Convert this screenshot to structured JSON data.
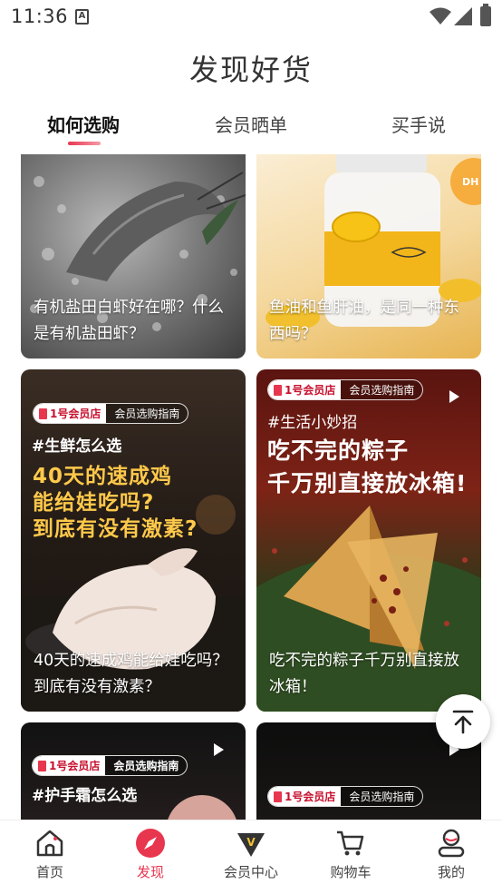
{
  "status_bar": {
    "time": "11:36",
    "sim_label": "A"
  },
  "header": {
    "title": "发现好货",
    "tabs": [
      {
        "label": "如何选购",
        "active": true
      },
      {
        "label": "会员晒单",
        "active": false
      },
      {
        "label": "买手说",
        "active": false
      }
    ]
  },
  "feed": {
    "cards": [
      {
        "caption": "有机盐田白虾好在哪？什么是有机盐田虾？"
      },
      {
        "caption": "鱼油和鱼肝油，是同一种东西吗？",
        "image_text": "DH"
      },
      {
        "caption": "40天的速成鸡能给娃吃吗？到底有没有激素？",
        "badge_logo": "1号会员店",
        "badge_text": "会员选购指南",
        "hashtag": "#生鲜怎么选",
        "headline": [
          "40天的速成鸡",
          "能给娃吃吗?",
          "到底有没有激素?"
        ]
      },
      {
        "caption": "吃不完的粽子千万别直接放冰箱！",
        "badge_logo": "1号会员店",
        "badge_text": "会员选购指南",
        "hashtag": "#生活小妙招",
        "headline": [
          "吃不完的粽子",
          "千万别直接放冰箱!"
        ]
      },
      {
        "badge_logo": "1号会员店",
        "badge_text": "会员选购指南",
        "hashtag": "#护手霜怎么选"
      },
      {
        "badge_logo": "1号会员店",
        "badge_text": "会员选购指南"
      }
    ]
  },
  "bottom_nav": {
    "items": [
      {
        "label": "首页",
        "icon": "home-icon"
      },
      {
        "label": "发现",
        "icon": "compass-icon",
        "active": true
      },
      {
        "label": "会员中心",
        "icon": "vip-badge-icon"
      },
      {
        "label": "购物车",
        "icon": "cart-icon"
      },
      {
        "label": "我的",
        "icon": "profile-icon"
      }
    ]
  },
  "colors": {
    "accent": "#e8364f",
    "headline": "#ffc94a"
  }
}
